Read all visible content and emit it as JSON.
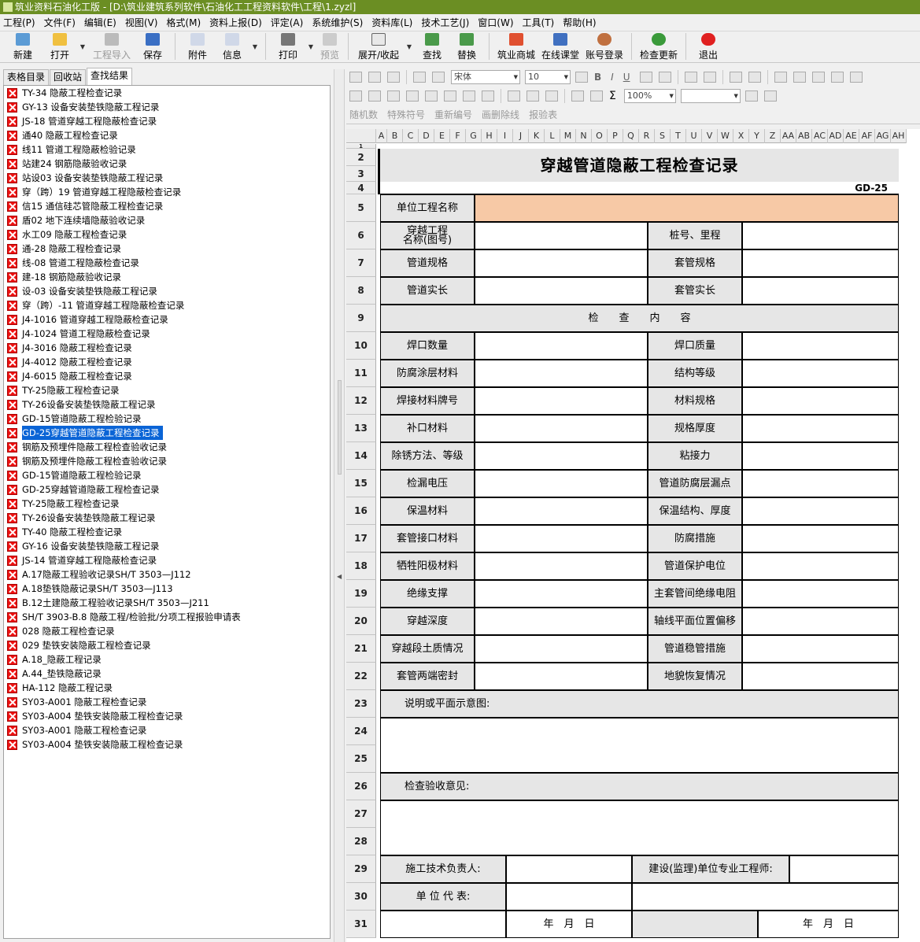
{
  "window": {
    "title": "筑业资料石油化工版 - [D:\\筑业建筑系列软件\\石油化工工程资料软件\\工程\\1.zyzl]"
  },
  "menu": [
    "工程(P)",
    "文件(F)",
    "编辑(E)",
    "视图(V)",
    "格式(M)",
    "资料上报(D)",
    "评定(A)",
    "系统维护(S)",
    "资料库(L)",
    "技术工艺(J)",
    "窗口(W)",
    "工具(T)",
    "帮助(H)"
  ],
  "toolbar": {
    "new": "新建",
    "open": "打开",
    "import": "工程导入",
    "save": "保存",
    "attach": "附件",
    "info": "信息",
    "print": "打印",
    "preview": "预览",
    "expand": "展开/收起",
    "find": "查找",
    "replace": "替换",
    "mall": "筑业商城",
    "classroom": "在线课堂",
    "login": "账号登录",
    "update": "检查更新",
    "exit": "退出"
  },
  "tabs": [
    "表格目录",
    "回收站",
    "查找结果"
  ],
  "results": [
    "TY-34 隐蔽工程检查记录",
    "GY-13 设备安装垫铁隐蔽工程记录",
    "JS-18 管道穿越工程隐蔽检查记录",
    "通40 隐蔽工程检查记录",
    "线11 管道工程隐蔽检验记录",
    "站建24 钢筋隐蔽验收记录",
    "站设03 设备安装垫铁隐蔽工程记录",
    "穿（跨）19 管道穿越工程隐蔽检查记录",
    "信15 通信硅芯管隐蔽工程检查记录",
    "盾02 地下连续墙隐蔽验收记录",
    "水工09 隐蔽工程检查记录",
    "通-28 隐蔽工程检查记录",
    "线-08 管道工程隐蔽检查记录",
    "建-18 钢筋隐蔽验收记录",
    "设-03 设备安装垫铁隐蔽工程记录",
    "穿（跨）-11 管道穿越工程隐蔽检查记录",
    "J4-1016 管道穿越工程隐蔽检查记录",
    "J4-1024 管道工程隐蔽检查记录",
    "J4-3016 隐蔽工程检查记录",
    "J4-4012 隐蔽工程检查记录",
    "J4-6015 隐蔽工程检查记录",
    "TY-25隐蔽工程检查记录",
    "TY-26设备安装垫铁隐蔽工程记录",
    "GD-15管道隐蔽工程检验记录",
    "GD-25穿越管道隐蔽工程检查记录",
    "钢筋及预埋件隐蔽工程检查验收记录",
    "钢筋及预埋件隐蔽工程检查验收记录",
    "GD-15管道隐蔽工程检验记录",
    "GD-25穿越管道隐蔽工程检查记录",
    "TY-25隐蔽工程检查记录",
    "TY-26设备安装垫铁隐蔽工程记录",
    "TY-40 隐蔽工程检查记录",
    "GY-16 设备安装垫铁隐蔽工程记录",
    "JS-14 管道穿越工程隐蔽检查记录",
    "A.17隐蔽工程验收记录SH/T 3503—J112",
    "A.18垫铁隐蔽记录SH/T 3503—J113",
    "B.12土建隐蔽工程验收记录SH/T 3503—J211",
    "SH/T 3903-B.8 隐蔽工程/检验批/分项工程报验申请表",
    "028 隐蔽工程检查记录",
    "029 垫铁安装隐蔽工程检查记录",
    "A.18_隐蔽工程记录",
    "A.44_垫铁隐蔽记录",
    "HA-112 隐蔽工程记录",
    "SY03-A001 隐蔽工程检查记录",
    "SY03-A004 垫铁安装隐蔽工程检查记录",
    "SY03-A001 隐蔽工程检查记录",
    "SY03-A004 垫铁安装隐蔽工程检查记录"
  ],
  "selected_index": 24,
  "format": {
    "font": "宋体",
    "size": "10",
    "zoom": "100%",
    "bold": "B",
    "italic": "I",
    "underline": "U",
    "sum": "Σ"
  },
  "format_bar3": [
    "随机数",
    "特殊符号",
    "重新编号",
    "画删除线",
    "报验表"
  ],
  "columns": [
    "A",
    "B",
    "C",
    "D",
    "E",
    "F",
    "G",
    "H",
    "I",
    "J",
    "K",
    "L",
    "M",
    "N",
    "O",
    "P",
    "Q",
    "R",
    "S",
    "T",
    "U",
    "V",
    "W",
    "X",
    "Y",
    "Z",
    "AA",
    "AB",
    "AC",
    "AD",
    "AE",
    "AF",
    "AG",
    "AH"
  ],
  "rows": [
    "1",
    "2",
    "3",
    "4",
    "5",
    "6",
    "7",
    "8",
    "9",
    "10",
    "11",
    "12",
    "13",
    "14",
    "15",
    "16",
    "17",
    "18",
    "19",
    "20",
    "21",
    "22",
    "23",
    "24",
    "25",
    "26",
    "27",
    "28",
    "29",
    "30",
    "31"
  ],
  "form": {
    "title": "穿越管道隐蔽工程检查记录",
    "code": "GD-25",
    "unit_name": "单位工程名称",
    "r6a": "穿越工程\n名称(图号)",
    "r6b": "桩号、里程",
    "r7a": "管道规格",
    "r7b": "套管规格",
    "r8a": "管道实长",
    "r8b": "套管实长",
    "section": "检　　查　　内　　容",
    "pairs": [
      [
        "焊口数量",
        "焊口质量"
      ],
      [
        "防腐涂层材料",
        "结构等级"
      ],
      [
        "焊接材料牌号",
        "材料规格"
      ],
      [
        "补口材料",
        "规格厚度"
      ],
      [
        "除锈方法、等级",
        "粘接力"
      ],
      [
        "检漏电压",
        "管道防腐层漏点"
      ],
      [
        "保温材料",
        "保温结构、厚度"
      ],
      [
        "套管接口材料",
        "防腐措施"
      ],
      [
        "牺牲阳极材料",
        "管道保护电位"
      ],
      [
        "绝缘支撑",
        "主套管间绝缘电阻"
      ],
      [
        "穿越深度",
        "轴线平面位置偏移"
      ],
      [
        "穿越段土质情况",
        "管道稳管措施"
      ],
      [
        "套管两端密封",
        "地貌恢复情况"
      ]
    ],
    "desc": "说明或平面示意图:",
    "opinion": "检查验收意见:",
    "tech_lead": "施工技术负责人:",
    "supervisor": "建设(监理)单位专业工程师:",
    "unit_rep": "单 位 代 表:",
    "date1": "年　月　日",
    "date2": "年　月　日"
  }
}
